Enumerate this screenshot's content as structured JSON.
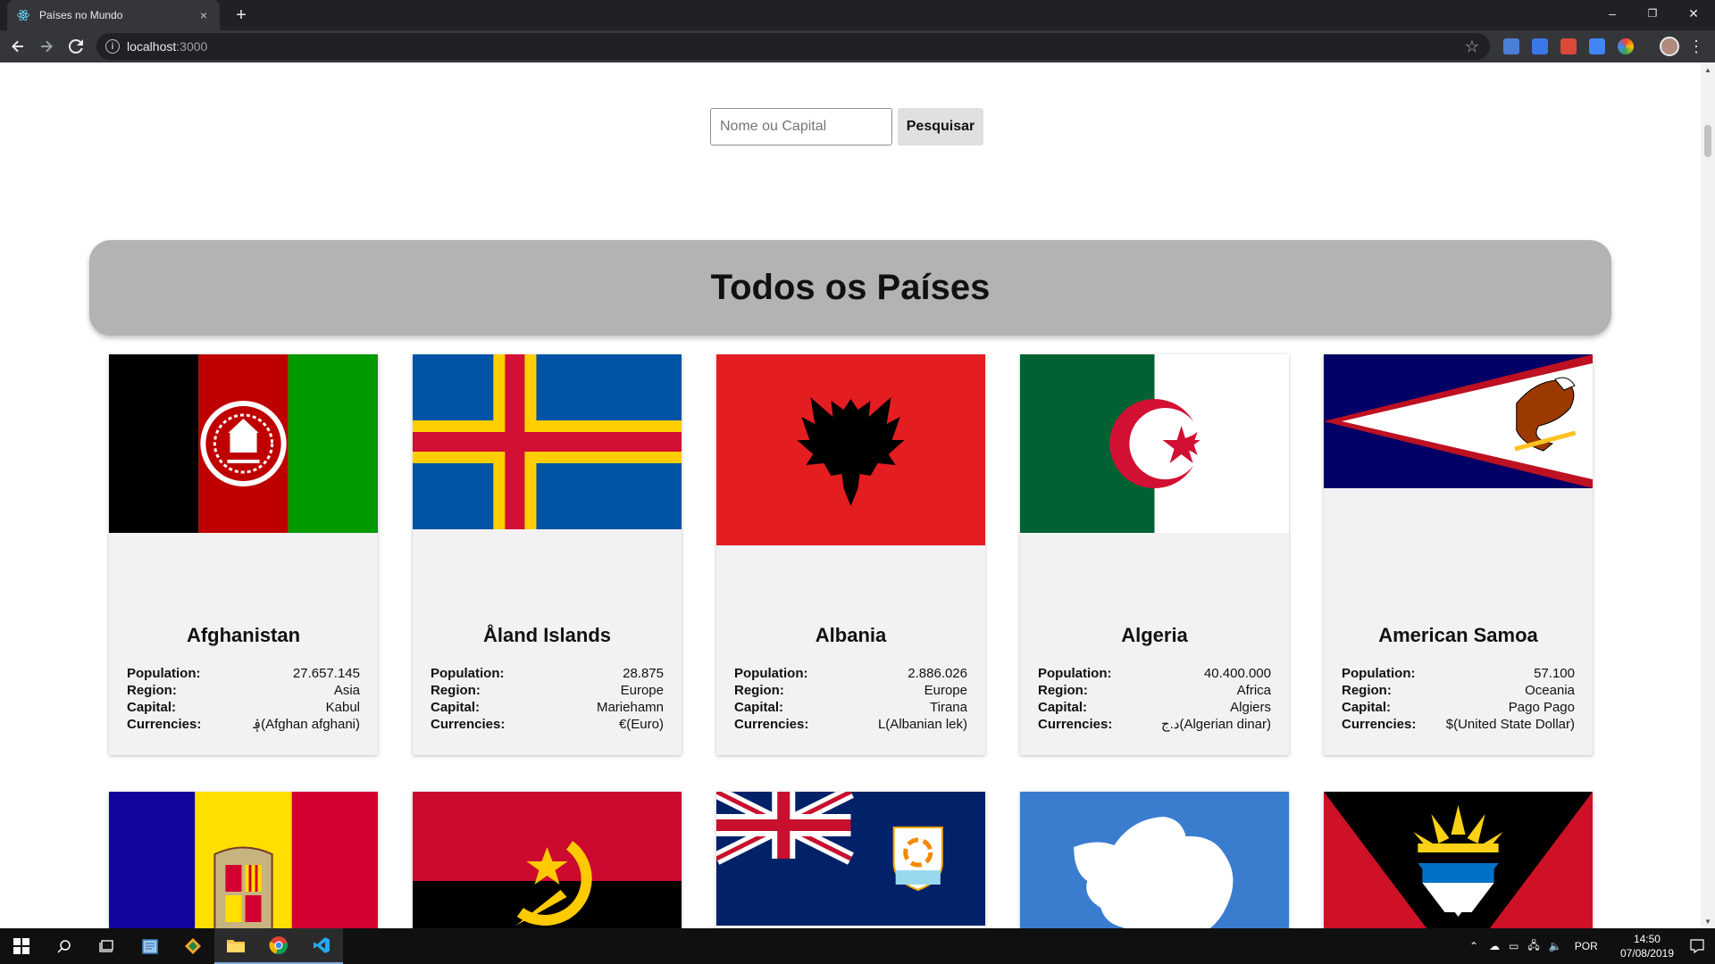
{
  "browser": {
    "tab_title": "Países no Mundo",
    "tab_close": "×",
    "new_tab": "+",
    "url_host": "localhost",
    "url_port": ":3000",
    "window_controls": [
      "–",
      "❐",
      "✕"
    ]
  },
  "search": {
    "placeholder": "Nome ou Capital",
    "button_label": "Pesquisar"
  },
  "page_title": "Todos os Países",
  "labels": {
    "population": "Population:",
    "region": "Region:",
    "capital": "Capital:",
    "currencies": "Currencies:"
  },
  "countries": [
    {
      "name": "Afghanistan",
      "population": "27.657.145",
      "region": "Asia",
      "capital": "Kabul",
      "currencies": "؋(Afghan afghani)"
    },
    {
      "name": "Åland Islands",
      "population": "28.875",
      "region": "Europe",
      "capital": "Mariehamn",
      "currencies": "€(Euro)"
    },
    {
      "name": "Albania",
      "population": "2.886.026",
      "region": "Europe",
      "capital": "Tirana",
      "currencies": "L(Albanian lek)"
    },
    {
      "name": "Algeria",
      "population": "40.400.000",
      "region": "Africa",
      "capital": "Algiers",
      "currencies": "د.ج(Algerian dinar)"
    },
    {
      "name": "American Samoa",
      "population": "57.100",
      "region": "Oceania",
      "capital": "Pago Pago",
      "currencies": "$(United State Dollar)"
    }
  ],
  "taskbar": {
    "language": "POR",
    "time": "14:50",
    "date": "07/08/2019"
  }
}
